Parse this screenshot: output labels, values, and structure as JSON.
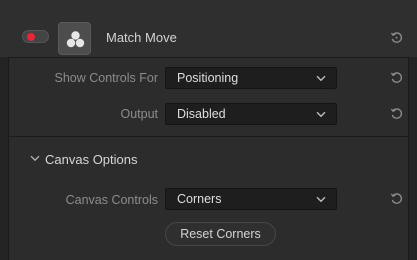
{
  "header": {
    "title": "Match Move",
    "toggle_color": "#e8263b",
    "icons": [
      "toggle-switch",
      "fx-icon",
      "reset-icon"
    ]
  },
  "controls": {
    "show_controls_for": {
      "label": "Show Controls For",
      "value": "Positioning"
    },
    "output": {
      "label": "Output",
      "value": "Disabled"
    }
  },
  "canvas_options": {
    "section_label": "Canvas Options",
    "canvas_controls": {
      "label": "Canvas Controls",
      "value": "Corners"
    },
    "reset_button_label": "Reset Corners"
  }
}
